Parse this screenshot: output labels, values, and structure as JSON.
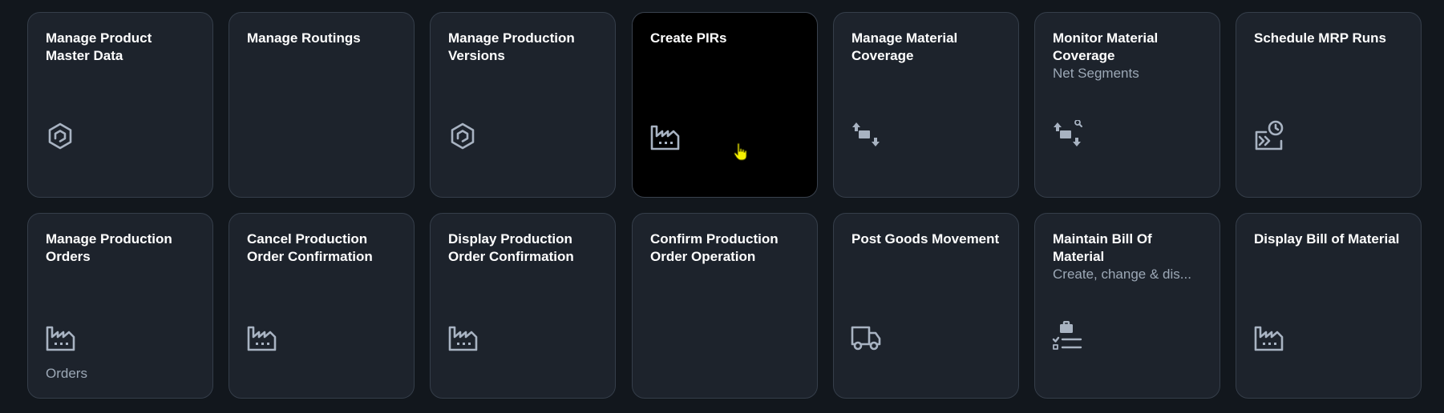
{
  "colors": {
    "tile_bg": "#1d232c",
    "tile_selected_bg": "#000000",
    "icon": "#a8b3c2",
    "cursor": "#f5f000"
  },
  "tiles": [
    {
      "title": "Manage Product Master Data",
      "subtitle": "",
      "footer": "",
      "icon": "product-icon"
    },
    {
      "title": "Manage Routings",
      "subtitle": "",
      "footer": "",
      "icon": ""
    },
    {
      "title": "Manage Production Versions",
      "subtitle": "",
      "footer": "",
      "icon": "product-icon"
    },
    {
      "title": "Create PIRs",
      "subtitle": "",
      "footer": "",
      "icon": "factory-icon",
      "selected": true
    },
    {
      "title": "Manage Material Coverage",
      "subtitle": "",
      "footer": "",
      "icon": "material-flow-icon"
    },
    {
      "title": "Monitor Material Coverage",
      "subtitle": "Net Segments",
      "footer": "",
      "icon": "material-flow-search-icon"
    },
    {
      "title": "Schedule MRP Runs",
      "subtitle": "",
      "footer": "",
      "icon": "scheduled-run-icon"
    },
    {
      "title": "Manage Production Orders",
      "subtitle": "",
      "footer": "Orders",
      "icon": "factory-icon"
    },
    {
      "title": "Cancel Production Order Confirmation",
      "subtitle": "",
      "footer": "",
      "icon": "factory-icon"
    },
    {
      "title": "Display Production Order Confirmation",
      "subtitle": "",
      "footer": "",
      "icon": "factory-icon"
    },
    {
      "title": "Confirm Production Order Operation",
      "subtitle": "",
      "footer": "",
      "icon": ""
    },
    {
      "title": "Post Goods Movement",
      "subtitle": "",
      "footer": "",
      "icon": "truck-icon"
    },
    {
      "title": "Maintain Bill Of Material",
      "subtitle": "Create, change & dis...",
      "footer": "",
      "icon": "bill-of-material-icon"
    },
    {
      "title": "Display Bill of Material",
      "subtitle": "",
      "footer": "",
      "icon": "factory-icon"
    }
  ]
}
